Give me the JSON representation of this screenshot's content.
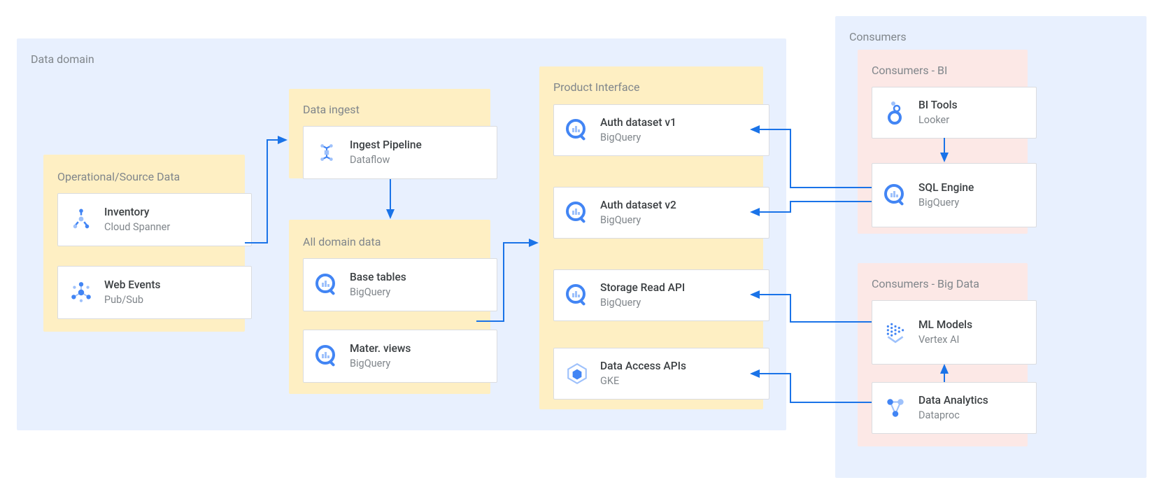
{
  "colors": {
    "blue": "#4285f4",
    "blue2": "#1a73e8",
    "grey": "#5f6368",
    "beige": "#feefc3",
    "pink": "#fce8e6",
    "panel": "#e8f0fe",
    "txt": "#80868b"
  },
  "domain": {
    "title": "Data domain",
    "source": {
      "title": "Operational/Source Data",
      "items": [
        {
          "title": "Inventory",
          "sub": "Cloud Spanner",
          "icon": "spanner"
        },
        {
          "title": "Web Events",
          "sub": "Pub/Sub",
          "icon": "pubsub"
        }
      ]
    },
    "ingest": {
      "title": "Data ingest",
      "items": [
        {
          "title": "Ingest Pipeline",
          "sub": "Dataflow",
          "icon": "dataflow"
        }
      ]
    },
    "alldata": {
      "title": "All domain data",
      "items": [
        {
          "title": "Base tables",
          "sub": "BigQuery",
          "icon": "bq"
        },
        {
          "title": "Mater. views",
          "sub": "BigQuery",
          "icon": "bq"
        }
      ]
    },
    "product": {
      "title": "Product Interface",
      "items": [
        {
          "title": "Auth dataset v1",
          "sub": "BigQuery",
          "icon": "bq"
        },
        {
          "title": "Auth dataset v2",
          "sub": "BigQuery",
          "icon": "bq"
        },
        {
          "title": "Storage Read API",
          "sub": "BigQuery",
          "icon": "bq"
        },
        {
          "title": "Data Access APIs",
          "sub": "GKE",
          "icon": "gke"
        }
      ]
    }
  },
  "consumers": {
    "title": "Consumers",
    "bi": {
      "title": "Consumers - BI",
      "items": [
        {
          "title": "BI Tools",
          "sub": "Looker",
          "icon": "looker"
        },
        {
          "title": "SQL Engine",
          "sub": "BigQuery",
          "icon": "bq"
        }
      ]
    },
    "bigdata": {
      "title": "Consumers - Big Data",
      "items": [
        {
          "title": "ML Models",
          "sub": "Vertex AI",
          "icon": "vertex"
        },
        {
          "title": "Data Analytics",
          "sub": "Dataproc",
          "icon": "dataproc"
        }
      ]
    }
  }
}
